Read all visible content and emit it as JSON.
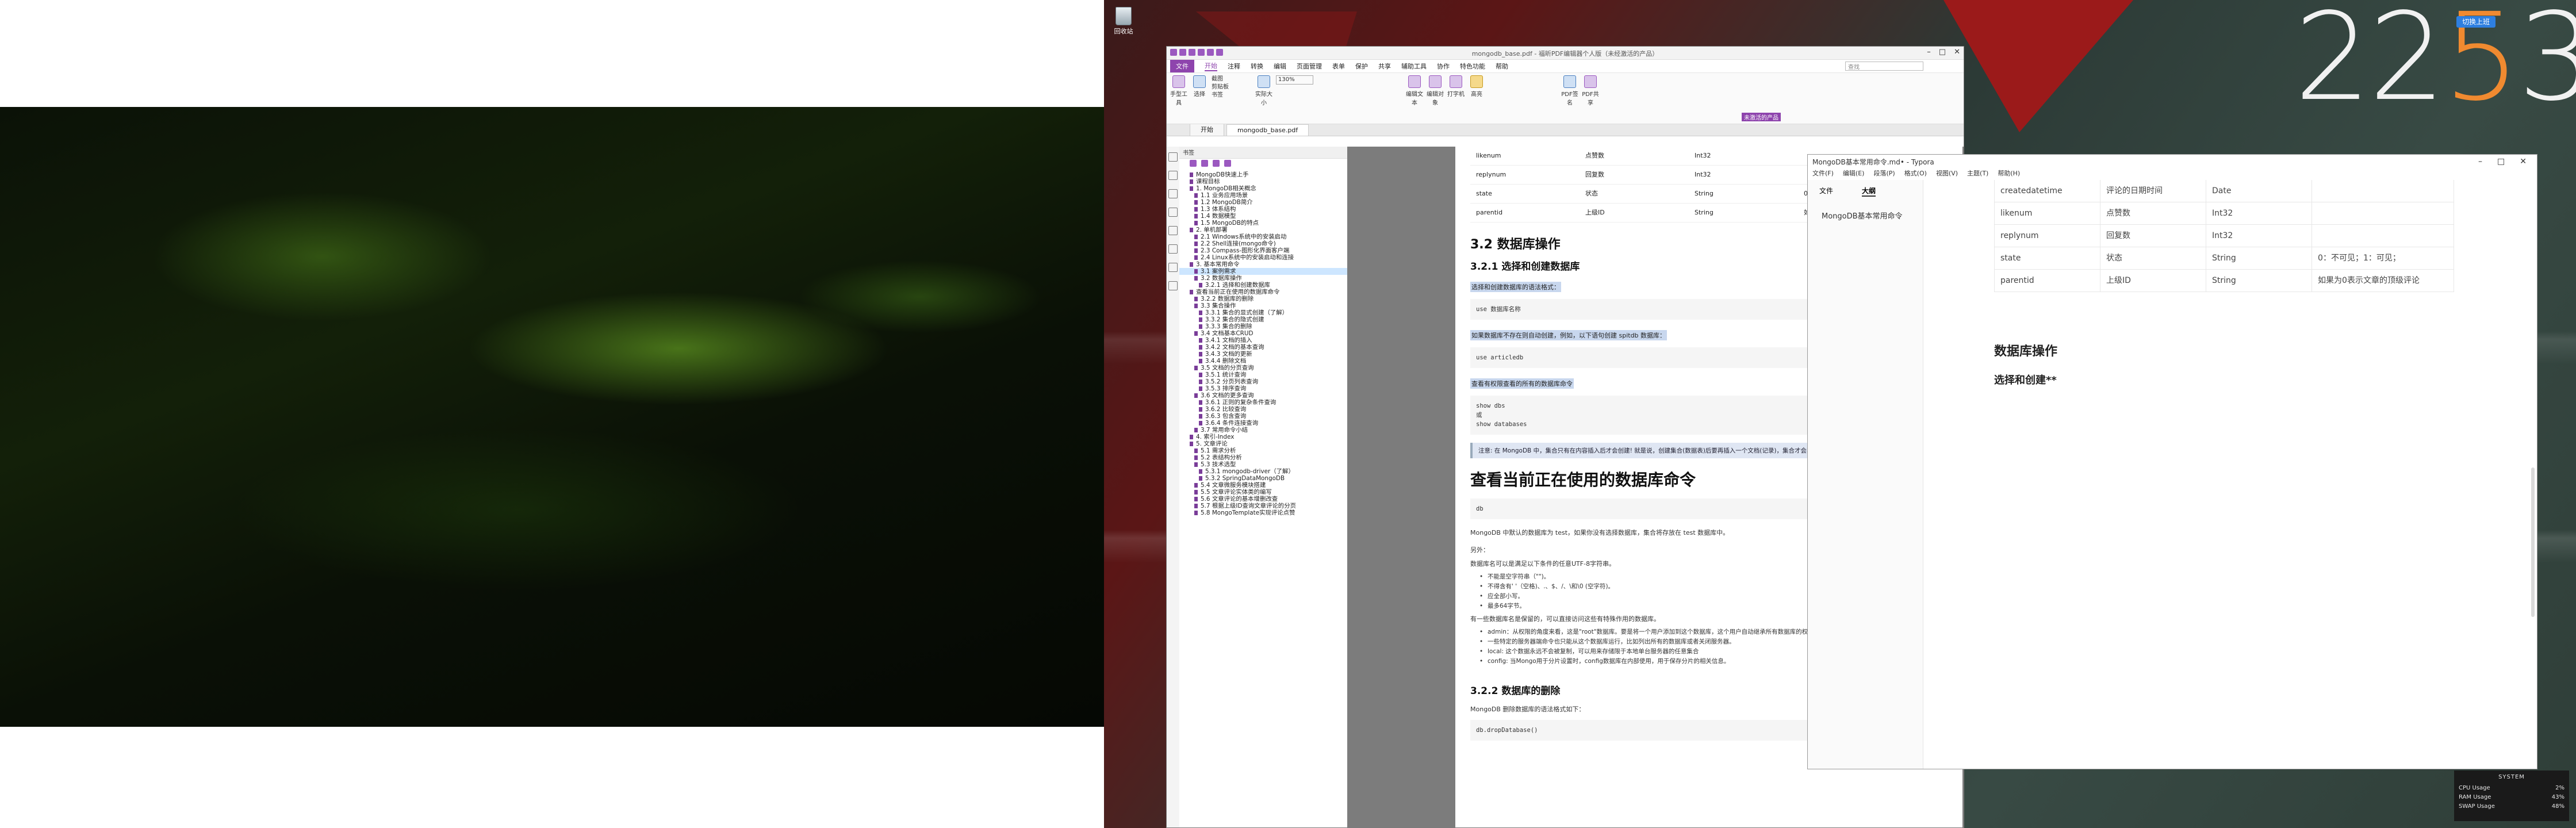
{
  "desktop": {
    "recycle_bin_label": "回收站",
    "clock": {
      "time_plain": "22",
      "time_accent": "5",
      "time_plain2": "3",
      "badge": "切换上班"
    }
  },
  "pdf": {
    "window_title": "mongodb_base.pdf - 福昕PDF编辑器个人版（未经激活的产品）",
    "menu": [
      "文件",
      "开始",
      "注释",
      "转换",
      "编辑",
      "页面管理",
      "表单",
      "保护",
      "共享",
      "辅助工具",
      "协作",
      "特色功能",
      "帮助"
    ],
    "search_placeholder": "查找",
    "ribbon": {
      "hand": "手型工具",
      "select": "选择",
      "screenshot": "截图",
      "clipboard": "剪贴板",
      "bookmark": "书签",
      "actual": "实际大小",
      "zoom": "130%",
      "edit_text": "编辑文本",
      "edit_obj": "编辑对象",
      "typewriter": "打字机",
      "highlight": "高亮",
      "pdf_sign": "PDF签名",
      "pdf_share": "PDF共享",
      "ribbon_note": "未激活的产品"
    },
    "tabs": [
      "开始",
      "mongodb_base.pdf"
    ],
    "bookmarks_title": "书签",
    "bookmarks": [
      "MongoDB快速上手",
      "课程目标",
      "1. MongoDB相关概念",
      "1.1 业务应用场景",
      "1.2 MongoDB简介",
      "1.3 体系结构",
      "1.4 数据模型",
      "1.5 MongoDB的特点",
      "2. 单机部署",
      "2.1 Windows系统中的安装启动",
      "2.2 Shell连接(mongo命令)",
      "2.3 Compass-图形化界面客户端",
      "2.4 Linux系统中的安装启动和连接",
      "3. 基本常用命令",
      "3.1 案例需求",
      "3.2 数据库操作",
      "3.2.1 选择和创建数据库",
      "查看当前正在使用的数据库命令",
      "3.2.2 数据库的删除",
      "3.3 集合操作",
      "3.3.1 集合的显式创建（了解）",
      "3.3.2 集合的隐式创建",
      "3.3.3 集合的删除",
      "3.4 文档基本CRUD",
      "3.4.1 文档的插入",
      "3.4.2 文档的基本查询",
      "3.4.3 文档的更新",
      "3.4.4 删除文档",
      "3.5 文档的分页查询",
      "3.5.1 统计查询",
      "3.5.2 分页列表查询",
      "3.5.3 排序查询",
      "3.6 文档的更多查询",
      "3.6.1 正则的复杂条件查询",
      "3.6.2 比较查询",
      "3.6.3 包含查询",
      "3.6.4 条件连接查询",
      "3.7 常用命令小结",
      "4. 索引-Index",
      "5. 文章评论",
      "5.1 需求分析",
      "5.2 表结构分析",
      "5.3 技术选型",
      "5.3.1 mongodb-driver（了解）",
      "5.3.2 SpringDataMongoDB",
      "5.4 文章微服务模块搭建",
      "5.5 文章评论实体类的编写",
      "5.6 文章评论的基本增删改查",
      "5.7 根据上级ID查询文章评论的分页",
      "5.8 MongoTemplate实现评论点赞"
    ],
    "page": {
      "table": [
        [
          "likenum",
          "点赞数",
          "Int32",
          ""
        ],
        [
          "replynum",
          "回复数",
          "Int32",
          ""
        ],
        [
          "state",
          "状态",
          "String",
          "0：不可见；1："
        ],
        [
          "parentid",
          "上级ID",
          "String",
          "如果为0表示文"
        ]
      ],
      "h_db_ops": "3.2 数据库操作",
      "h_select": "3.2.1 选择和创建数据库",
      "hl_syntax": "选择和创建数据库的语法格式：",
      "code_use": "use 数据库名称",
      "hl_auto": "如果数据库不存在则自动创建，例如，以下语句创建 spitdb 数据库：",
      "code_use2": "use articledb",
      "hl_show": "查看有权限查看的所有的数据库命令",
      "code_show": "show dbs\n或\nshow databases",
      "note": "注意: 在 MongoDB 中，集合只有在内容插入后才会创建! 就是说，创建集合(数据表)后要再插入一个文档(记录)，集合才会真正创建。",
      "h_current": "查看当前正在使用的数据库命令",
      "code_db": "db",
      "p_default": "MongoDB 中默认的数据库为 test，如果你没有选择数据库，集合将存放在 test 数据库中。",
      "p_else": "另外：",
      "p_naming": "数据库名可以是满足以下条件的任意UTF-8字符串。",
      "rules": [
        "不能是空字符串（\"\")。",
        "不得含有' '（空格)、.、$、/、\\和\\0 (空字符)。",
        "应全部小写。",
        "最多64字节。"
      ],
      "p_reserved": "有一些数据库名是保留的，可以直接访问这些有特殊作用的数据库。",
      "reserved": [
        "admin：从权限的角度来看，这是\"root\"数据库。要是将一个用户添加到这个数据库，这个用户自动继承所有数据库的权限。",
        "一些特定的服务器端命令也只能从这个数据库运行，比如列出所有的数据库或者关闭服务器。",
        "local: 这个数据永远不会被复制，可以用来存储限于本地单台服务器的任意集合",
        "config: 当Mongo用于分片设置时，config数据库在内部使用，用于保存分片的相关信息。"
      ],
      "h_delete": "3.2.2 数据库的删除",
      "p_delete": "MongoDB 删除数据库的语法格式如下：",
      "code_drop": "db.dropDatabase()"
    }
  },
  "typora": {
    "title": "MongoDB基本常用命令.md• - Typora",
    "menu": [
      "文件(F)",
      "编辑(E)",
      "段落(P)",
      "格式(O)",
      "视图(V)",
      "主题(T)",
      "帮助(H)"
    ],
    "tab_files": "文件",
    "tab_outline": "大纲",
    "outline_item": "MongoDB基本常用命令",
    "table": [
      [
        "createdatetime",
        "评论的日期时间",
        "Date",
        ""
      ],
      [
        "likenum",
        "点赞数",
        "Int32",
        ""
      ],
      [
        "replynum",
        "回复数",
        "Int32",
        ""
      ],
      [
        "state",
        "状态",
        "String",
        "0：不可见；1：可见；"
      ],
      [
        "parentid",
        "上级ID",
        "String",
        "如果为0表示文章的顶级评论"
      ]
    ],
    "h2": "数据库操作",
    "h3": "选择和创建**"
  },
  "system_monitor": {
    "title": "SYSTEM",
    "rows": [
      [
        "CPU Usage",
        "2%"
      ],
      [
        "RAM Usage",
        "43%"
      ],
      [
        "SWAP Usage",
        "48%"
      ]
    ]
  }
}
